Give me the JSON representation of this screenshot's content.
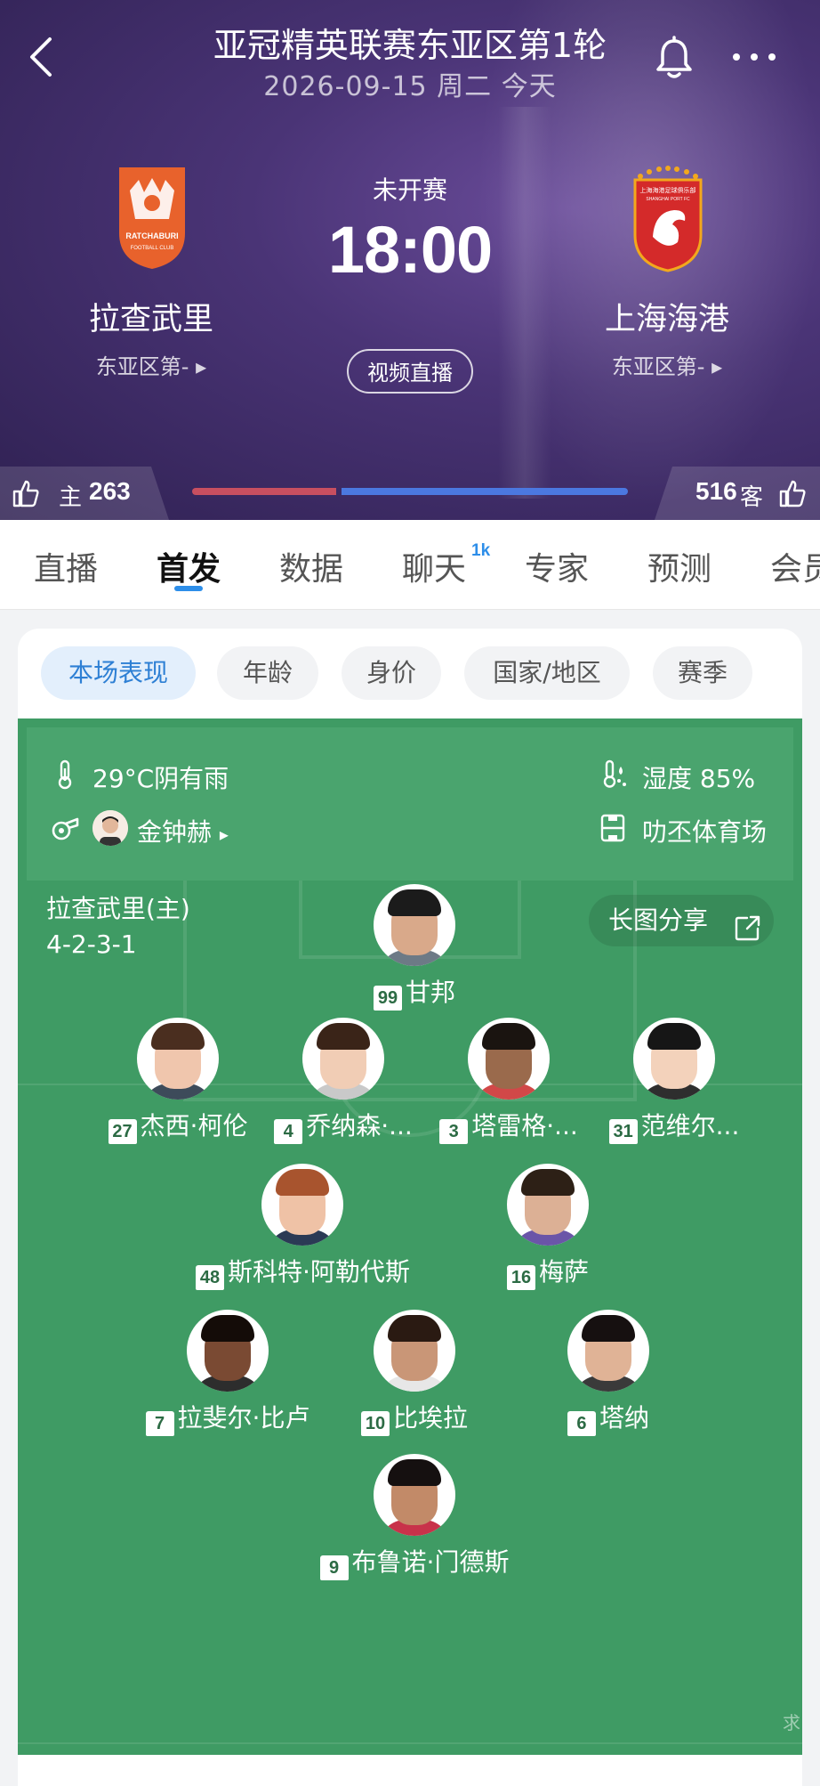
{
  "header": {
    "title": "亚冠精英联赛东亚区第1轮",
    "date_line": "2026-09-15 周二 今天",
    "status": "未开赛",
    "kickoff": "18:00",
    "video_button": "视频直播",
    "home": {
      "name": "拉查武里",
      "rank": "东亚区第-",
      "logo_text": "RATCHABURI",
      "logo_sub": "FOOTBALL CLUB",
      "color": "#e8622c"
    },
    "away": {
      "name": "上海海港",
      "rank": "东亚区第-",
      "logo_text": "上海海港足球俱乐部",
      "logo_sub": "SHANGHAI PORT FC",
      "color": "#d42a2a"
    }
  },
  "votes": {
    "home_label": "主",
    "home_count": "263",
    "away_label": "客",
    "away_count": "516",
    "home_color": "#c84f60",
    "away_color": "#4b78e0"
  },
  "tabs": [
    {
      "label": "直播"
    },
    {
      "label": "首发"
    },
    {
      "label": "数据"
    },
    {
      "label": "聊天",
      "badge": "1k"
    },
    {
      "label": "专家"
    },
    {
      "label": "预测"
    },
    {
      "label": "会员"
    }
  ],
  "filters": [
    "本场表现",
    "年龄",
    "身价",
    "国家/地区",
    "赛季"
  ],
  "match_info": {
    "weather": "29°C阴有雨",
    "humidity": "湿度 85%",
    "referee": "金钟赫",
    "stadium": "叻丕体育场"
  },
  "lineup": {
    "team_label": "拉查武里(主)",
    "formation": "4-2-3-1",
    "share_label": "长图分享",
    "players": [
      {
        "number": "99",
        "name": "甘邦",
        "skin": "#d9a98a",
        "hair": "#1b1b1b",
        "shirt": "#6d7a86"
      },
      {
        "number": "27",
        "name": "杰西·柯伦",
        "skin": "#f0c6ad",
        "hair": "#4a2e1f",
        "shirt": "#3d4b5a"
      },
      {
        "number": "4",
        "name": "乔纳森·...",
        "skin": "#f1cdb5",
        "hair": "#3a2418",
        "shirt": "#c9c9c9"
      },
      {
        "number": "3",
        "name": "塔雷格·...",
        "skin": "#9a6a4c",
        "hair": "#1a1410",
        "shirt": "#d14848"
      },
      {
        "number": "31",
        "name": "范维尔...",
        "skin": "#f3d2bb",
        "hair": "#161616",
        "shirt": "#2e2e2e"
      },
      {
        "number": "48",
        "name": "斯科特·阿勒代斯",
        "skin": "#efc2a6",
        "hair": "#a8542e",
        "shirt": "#2b3a55"
      },
      {
        "number": "16",
        "name": "梅萨",
        "skin": "#dcb095",
        "hair": "#2d2016",
        "shirt": "#6a55a8"
      },
      {
        "number": "7",
        "name": "拉斐尔·比卢",
        "skin": "#7a4a33",
        "hair": "#140c08",
        "shirt": "#2d2d2d"
      },
      {
        "number": "10",
        "name": "比埃拉",
        "skin": "#c99677",
        "hair": "#2a1a12",
        "shirt": "#e7e7e7"
      },
      {
        "number": "6",
        "name": "塔纳",
        "skin": "#e0b396",
        "hair": "#161010",
        "shirt": "#3a3a3a"
      },
      {
        "number": "9",
        "name": "布鲁诺·门德斯",
        "skin": "#c28a68",
        "hair": "#151010",
        "shirt": "#c8324a"
      }
    ]
  },
  "watermark": "求"
}
